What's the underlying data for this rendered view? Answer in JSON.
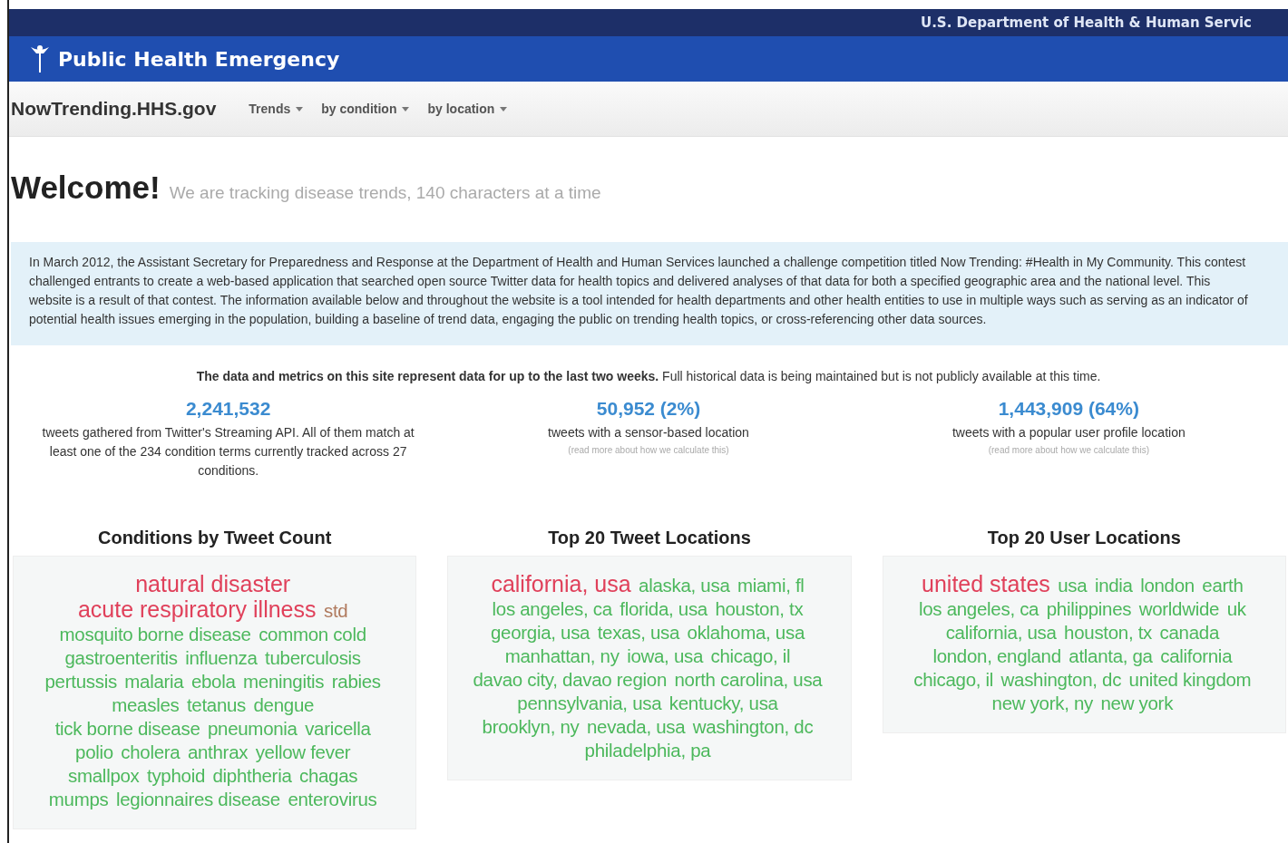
{
  "agency_bar": {
    "title": "U.S. Department of Health & Human Servic"
  },
  "banner": {
    "title": "Public Health Emergency"
  },
  "navbar": {
    "brand": "NowTrending.HHS.gov",
    "menus": [
      {
        "label": "Trends"
      },
      {
        "label": "by condition"
      },
      {
        "label": "by location"
      }
    ]
  },
  "welcome": {
    "heading": "Welcome!",
    "tagline": "We are tracking disease trends, 140 characters at a time"
  },
  "intro": "In March 2012, the Assistant Secretary for Preparedness and Response at the Department of Health and Human Services launched a challenge competition titled Now Trending: #Health in My Community. This contest challenged entrants to create a web-based application that searched open source Twitter data for health topics and delivered analyses of that data for both a specified geographic area and the national level. This website is a result of that contest. The information available below and throughout the website is a tool intended for health departments and other health entities to use in multiple ways such as serving as an indicator of potential health issues emerging in the population, building a baseline of trend data, engaging the public on trending health topics, or cross-referencing other data sources.",
  "notice": "**The data and metrics on this site represent data for up to the last two weeks.** Full historical data is being maintained but is not publicly available at this time.",
  "stats": [
    {
      "value": "2,241,532",
      "description": "tweets gathered from Twitter's Streaming API. All of them match at least one of the 234 condition terms currently tracked across 27 conditions."
    },
    {
      "value": "50,952 (2%)",
      "description": "tweets with a sensor-based location",
      "link": "(read more about how we calculate this)"
    },
    {
      "value": "1,443,909 (64%)",
      "description": "tweets with a popular user profile location",
      "link": "(read more about how we calculate this)"
    }
  ],
  "clouds": [
    {
      "title": "Conditions by Tweet Count",
      "terms": [
        {
          "text": "natural disaster",
          "kind": "large",
          "color": "#e0405a"
        },
        {
          "text": "acute respiratory illness",
          "kind": "large",
          "color": "#e0405a"
        },
        {
          "text": "std",
          "kind": "medium",
          "color": "#b07a5e"
        },
        {
          "text": "mosquito borne disease",
          "kind": "medium",
          "color": "#4cb85c"
        },
        {
          "text": "common cold",
          "kind": "medium",
          "color": "#4cb85c"
        },
        {
          "text": "gastroenteritis",
          "kind": "medium",
          "color": "#4cb85c"
        },
        {
          "text": "influenza",
          "kind": "medium",
          "color": "#4cb85c"
        },
        {
          "text": "tuberculosis",
          "kind": "medium",
          "color": "#4cb85c"
        },
        {
          "text": "pertussis",
          "kind": "medium",
          "color": "#4cb85c"
        },
        {
          "text": "malaria",
          "kind": "medium",
          "color": "#4cb85c"
        },
        {
          "text": "ebola",
          "kind": "medium",
          "color": "#4cb85c"
        },
        {
          "text": "meningitis",
          "kind": "medium",
          "color": "#4cb85c"
        },
        {
          "text": "rabies",
          "kind": "medium",
          "color": "#4cb85c"
        },
        {
          "text": "measles",
          "kind": "medium",
          "color": "#4cb85c"
        },
        {
          "text": "tetanus",
          "kind": "medium",
          "color": "#4cb85c"
        },
        {
          "text": "dengue",
          "kind": "medium",
          "color": "#4cb85c"
        },
        {
          "text": "tick borne disease",
          "kind": "medium",
          "color": "#4cb85c"
        },
        {
          "text": "pneumonia",
          "kind": "medium",
          "color": "#4cb85c"
        },
        {
          "text": "varicella",
          "kind": "medium",
          "color": "#4cb85c"
        },
        {
          "text": "polio",
          "kind": "medium",
          "color": "#4cb85c"
        },
        {
          "text": "cholera",
          "kind": "medium",
          "color": "#4cb85c"
        },
        {
          "text": "anthrax",
          "kind": "medium",
          "color": "#4cb85c"
        },
        {
          "text": "yellow fever",
          "kind": "medium",
          "color": "#4cb85c"
        },
        {
          "text": "smallpox",
          "kind": "medium",
          "color": "#4cb85c"
        },
        {
          "text": "typhoid",
          "kind": "medium",
          "color": "#4cb85c"
        },
        {
          "text": "diphtheria",
          "kind": "medium",
          "color": "#4cb85c"
        },
        {
          "text": "chagas",
          "kind": "medium",
          "color": "#4cb85c"
        },
        {
          "text": "mumps",
          "kind": "medium",
          "color": "#4cb85c"
        },
        {
          "text": "legionnaires disease",
          "kind": "medium",
          "color": "#4cb85c"
        },
        {
          "text": "enterovirus",
          "kind": "medium",
          "color": "#4cb85c"
        }
      ]
    },
    {
      "title": "Top 20 Tweet Locations",
      "terms": [
        {
          "text": "california, usa",
          "kind": "large",
          "color": "#e0405a"
        },
        {
          "text": "alaska, usa",
          "kind": "medium",
          "color": "#4cb85c"
        },
        {
          "text": "miami, fl",
          "kind": "medium",
          "color": "#4cb85c"
        },
        {
          "text": "los angeles, ca",
          "kind": "medium",
          "color": "#4cb85c"
        },
        {
          "text": "florida, usa",
          "kind": "medium",
          "color": "#4cb85c"
        },
        {
          "text": "houston, tx",
          "kind": "medium",
          "color": "#4cb85c"
        },
        {
          "text": "georgia, usa",
          "kind": "medium",
          "color": "#4cb85c"
        },
        {
          "text": "texas, usa",
          "kind": "medium",
          "color": "#4cb85c"
        },
        {
          "text": "oklahoma, usa",
          "kind": "medium",
          "color": "#4cb85c"
        },
        {
          "text": "manhattan, ny",
          "kind": "medium",
          "color": "#4cb85c"
        },
        {
          "text": "iowa, usa",
          "kind": "medium",
          "color": "#4cb85c"
        },
        {
          "text": "chicago, il",
          "kind": "medium",
          "color": "#4cb85c"
        },
        {
          "text": "davao city, davao region",
          "kind": "medium",
          "color": "#4cb85c"
        },
        {
          "text": "north carolina, usa",
          "kind": "medium",
          "color": "#4cb85c"
        },
        {
          "text": "pennsylvania, usa",
          "kind": "medium",
          "color": "#4cb85c"
        },
        {
          "text": "kentucky, usa",
          "kind": "medium",
          "color": "#4cb85c"
        },
        {
          "text": "brooklyn, ny",
          "kind": "medium",
          "color": "#4cb85c"
        },
        {
          "text": "nevada, usa",
          "kind": "medium",
          "color": "#4cb85c"
        },
        {
          "text": "washington, dc",
          "kind": "medium",
          "color": "#4cb85c"
        },
        {
          "text": "philadelphia, pa",
          "kind": "medium",
          "color": "#4cb85c"
        }
      ]
    },
    {
      "title": "Top 20 User Locations",
      "terms": [
        {
          "text": "united states",
          "kind": "large",
          "color": "#e0405a"
        },
        {
          "text": "usa",
          "kind": "medium",
          "color": "#4cb85c"
        },
        {
          "text": "india",
          "kind": "medium",
          "color": "#4cb85c"
        },
        {
          "text": "london",
          "kind": "medium",
          "color": "#4cb85c"
        },
        {
          "text": "earth",
          "kind": "medium",
          "color": "#4cb85c"
        },
        {
          "text": "los angeles, ca",
          "kind": "medium",
          "color": "#4cb85c"
        },
        {
          "text": "philippines",
          "kind": "medium",
          "color": "#4cb85c"
        },
        {
          "text": "worldwide",
          "kind": "medium",
          "color": "#4cb85c"
        },
        {
          "text": "uk",
          "kind": "medium",
          "color": "#4cb85c"
        },
        {
          "text": "california, usa",
          "kind": "medium",
          "color": "#4cb85c"
        },
        {
          "text": "houston, tx",
          "kind": "medium",
          "color": "#4cb85c"
        },
        {
          "text": "canada",
          "kind": "medium",
          "color": "#4cb85c"
        },
        {
          "text": "london, england",
          "kind": "medium",
          "color": "#4cb85c"
        },
        {
          "text": "atlanta, ga",
          "kind": "medium",
          "color": "#4cb85c"
        },
        {
          "text": "california",
          "kind": "medium",
          "color": "#4cb85c"
        },
        {
          "text": "chicago, il",
          "kind": "medium",
          "color": "#4cb85c"
        },
        {
          "text": "washington, dc",
          "kind": "medium",
          "color": "#4cb85c"
        },
        {
          "text": "united kingdom",
          "kind": "medium",
          "color": "#4cb85c"
        },
        {
          "text": "new york, ny",
          "kind": "medium",
          "color": "#4cb85c"
        },
        {
          "text": "new york",
          "kind": "medium",
          "color": "#4cb85c"
        }
      ]
    }
  ]
}
